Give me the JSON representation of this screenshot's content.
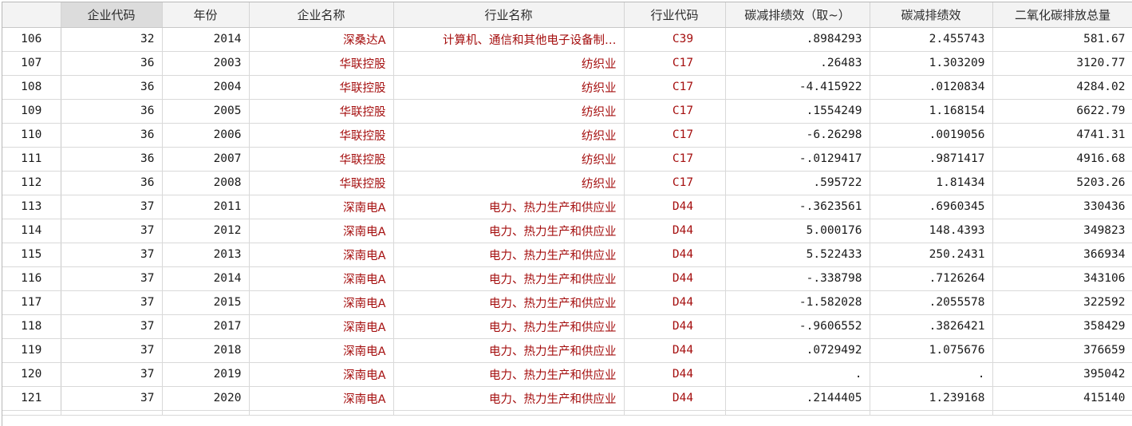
{
  "columns": [
    {
      "label": "企业代码",
      "selected": true
    },
    {
      "label": "年份"
    },
    {
      "label": "企业名称"
    },
    {
      "label": "行业名称"
    },
    {
      "label": "行业代码"
    },
    {
      "label": "碳减排绩效（取~）"
    },
    {
      "label": "碳减排绩效"
    },
    {
      "label": "二氧化碳排放总量"
    }
  ],
  "rows": [
    {
      "n": "106",
      "code": "32",
      "year": "2014",
      "name": "深桑达A",
      "industry": "计算机、通信和其他电子设备制…",
      "icode": "C39",
      "perf_tr": ".8984293",
      "perf": "2.455743",
      "co2": "581.67"
    },
    {
      "n": "107",
      "code": "36",
      "year": "2003",
      "name": "华联控股",
      "industry": "纺织业",
      "icode": "C17",
      "perf_tr": ".26483",
      "perf": "1.303209",
      "co2": "3120.77"
    },
    {
      "n": "108",
      "code": "36",
      "year": "2004",
      "name": "华联控股",
      "industry": "纺织业",
      "icode": "C17",
      "perf_tr": "-4.415922",
      "perf": ".0120834",
      "co2": "4284.02"
    },
    {
      "n": "109",
      "code": "36",
      "year": "2005",
      "name": "华联控股",
      "industry": "纺织业",
      "icode": "C17",
      "perf_tr": ".1554249",
      "perf": "1.168154",
      "co2": "6622.79"
    },
    {
      "n": "110",
      "code": "36",
      "year": "2006",
      "name": "华联控股",
      "industry": "纺织业",
      "icode": "C17",
      "perf_tr": "-6.26298",
      "perf": ".0019056",
      "co2": "4741.31"
    },
    {
      "n": "111",
      "code": "36",
      "year": "2007",
      "name": "华联控股",
      "industry": "纺织业",
      "icode": "C17",
      "perf_tr": "-.0129417",
      "perf": ".9871417",
      "co2": "4916.68"
    },
    {
      "n": "112",
      "code": "36",
      "year": "2008",
      "name": "华联控股",
      "industry": "纺织业",
      "icode": "C17",
      "perf_tr": ".595722",
      "perf": "1.81434",
      "co2": "5203.26"
    },
    {
      "n": "113",
      "code": "37",
      "year": "2011",
      "name": "深南电A",
      "industry": "电力、热力生产和供应业",
      "icode": "D44",
      "perf_tr": "-.3623561",
      "perf": ".6960345",
      "co2": "330436"
    },
    {
      "n": "114",
      "code": "37",
      "year": "2012",
      "name": "深南电A",
      "industry": "电力、热力生产和供应业",
      "icode": "D44",
      "perf_tr": "5.000176",
      "perf": "148.4393",
      "co2": "349823"
    },
    {
      "n": "115",
      "code": "37",
      "year": "2013",
      "name": "深南电A",
      "industry": "电力、热力生产和供应业",
      "icode": "D44",
      "perf_tr": "5.522433",
      "perf": "250.2431",
      "co2": "366934"
    },
    {
      "n": "116",
      "code": "37",
      "year": "2014",
      "name": "深南电A",
      "industry": "电力、热力生产和供应业",
      "icode": "D44",
      "perf_tr": "-.338798",
      "perf": ".7126264",
      "co2": "343106"
    },
    {
      "n": "117",
      "code": "37",
      "year": "2015",
      "name": "深南电A",
      "industry": "电力、热力生产和供应业",
      "icode": "D44",
      "perf_tr": "-1.582028",
      "perf": ".2055578",
      "co2": "322592"
    },
    {
      "n": "118",
      "code": "37",
      "year": "2017",
      "name": "深南电A",
      "industry": "电力、热力生产和供应业",
      "icode": "D44",
      "perf_tr": "-.9606552",
      "perf": ".3826421",
      "co2": "358429"
    },
    {
      "n": "119",
      "code": "37",
      "year": "2018",
      "name": "深南电A",
      "industry": "电力、热力生产和供应业",
      "icode": "D44",
      "perf_tr": ".0729492",
      "perf": "1.075676",
      "co2": "376659"
    },
    {
      "n": "120",
      "code": "37",
      "year": "2019",
      "name": "深南电A",
      "industry": "电力、热力生产和供应业",
      "icode": "D44",
      "perf_tr": ".",
      "perf": ".",
      "co2": "395042"
    },
    {
      "n": "121",
      "code": "37",
      "year": "2020",
      "name": "深南电A",
      "industry": "电力、热力生产和供应业",
      "icode": "D44",
      "perf_tr": ".2144405",
      "perf": "1.239168",
      "co2": "415140"
    }
  ]
}
